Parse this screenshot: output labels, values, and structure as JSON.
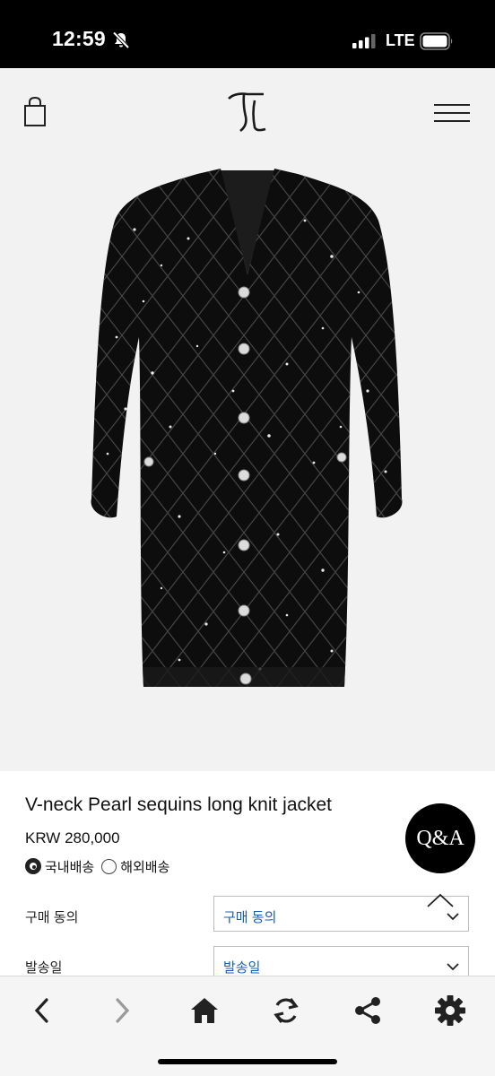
{
  "status_bar": {
    "time": "12:59",
    "network": "LTE",
    "bell_icon": "bell-slash-icon"
  },
  "header": {
    "bag_icon": "shopping-bag-icon",
    "logo_icon": "brand-logo",
    "menu_icon": "hamburger-menu-icon"
  },
  "product": {
    "image_icon": "black-sequin-knit-jacket-photo",
    "title": "V-neck Pearl sequins long knit jacket",
    "price": "KRW 280,000",
    "shipping_options": [
      {
        "label": "국내배송",
        "selected": true
      },
      {
        "label": "해외배송",
        "selected": false
      }
    ]
  },
  "qa_button": {
    "label": "Q&A"
  },
  "options": [
    {
      "label": "구매 동의",
      "value": "구매 동의"
    },
    {
      "label": "발송일",
      "value": "발송일"
    }
  ],
  "toolbar": {
    "items": [
      "back-icon",
      "forward-icon",
      "home-icon",
      "reload-icon",
      "share-icon",
      "settings-icon"
    ]
  },
  "colors": {
    "accent_link": "#1a5fb4",
    "toolbar_icon": "#222222",
    "toolbar_disabled": "#9a9a9a"
  }
}
